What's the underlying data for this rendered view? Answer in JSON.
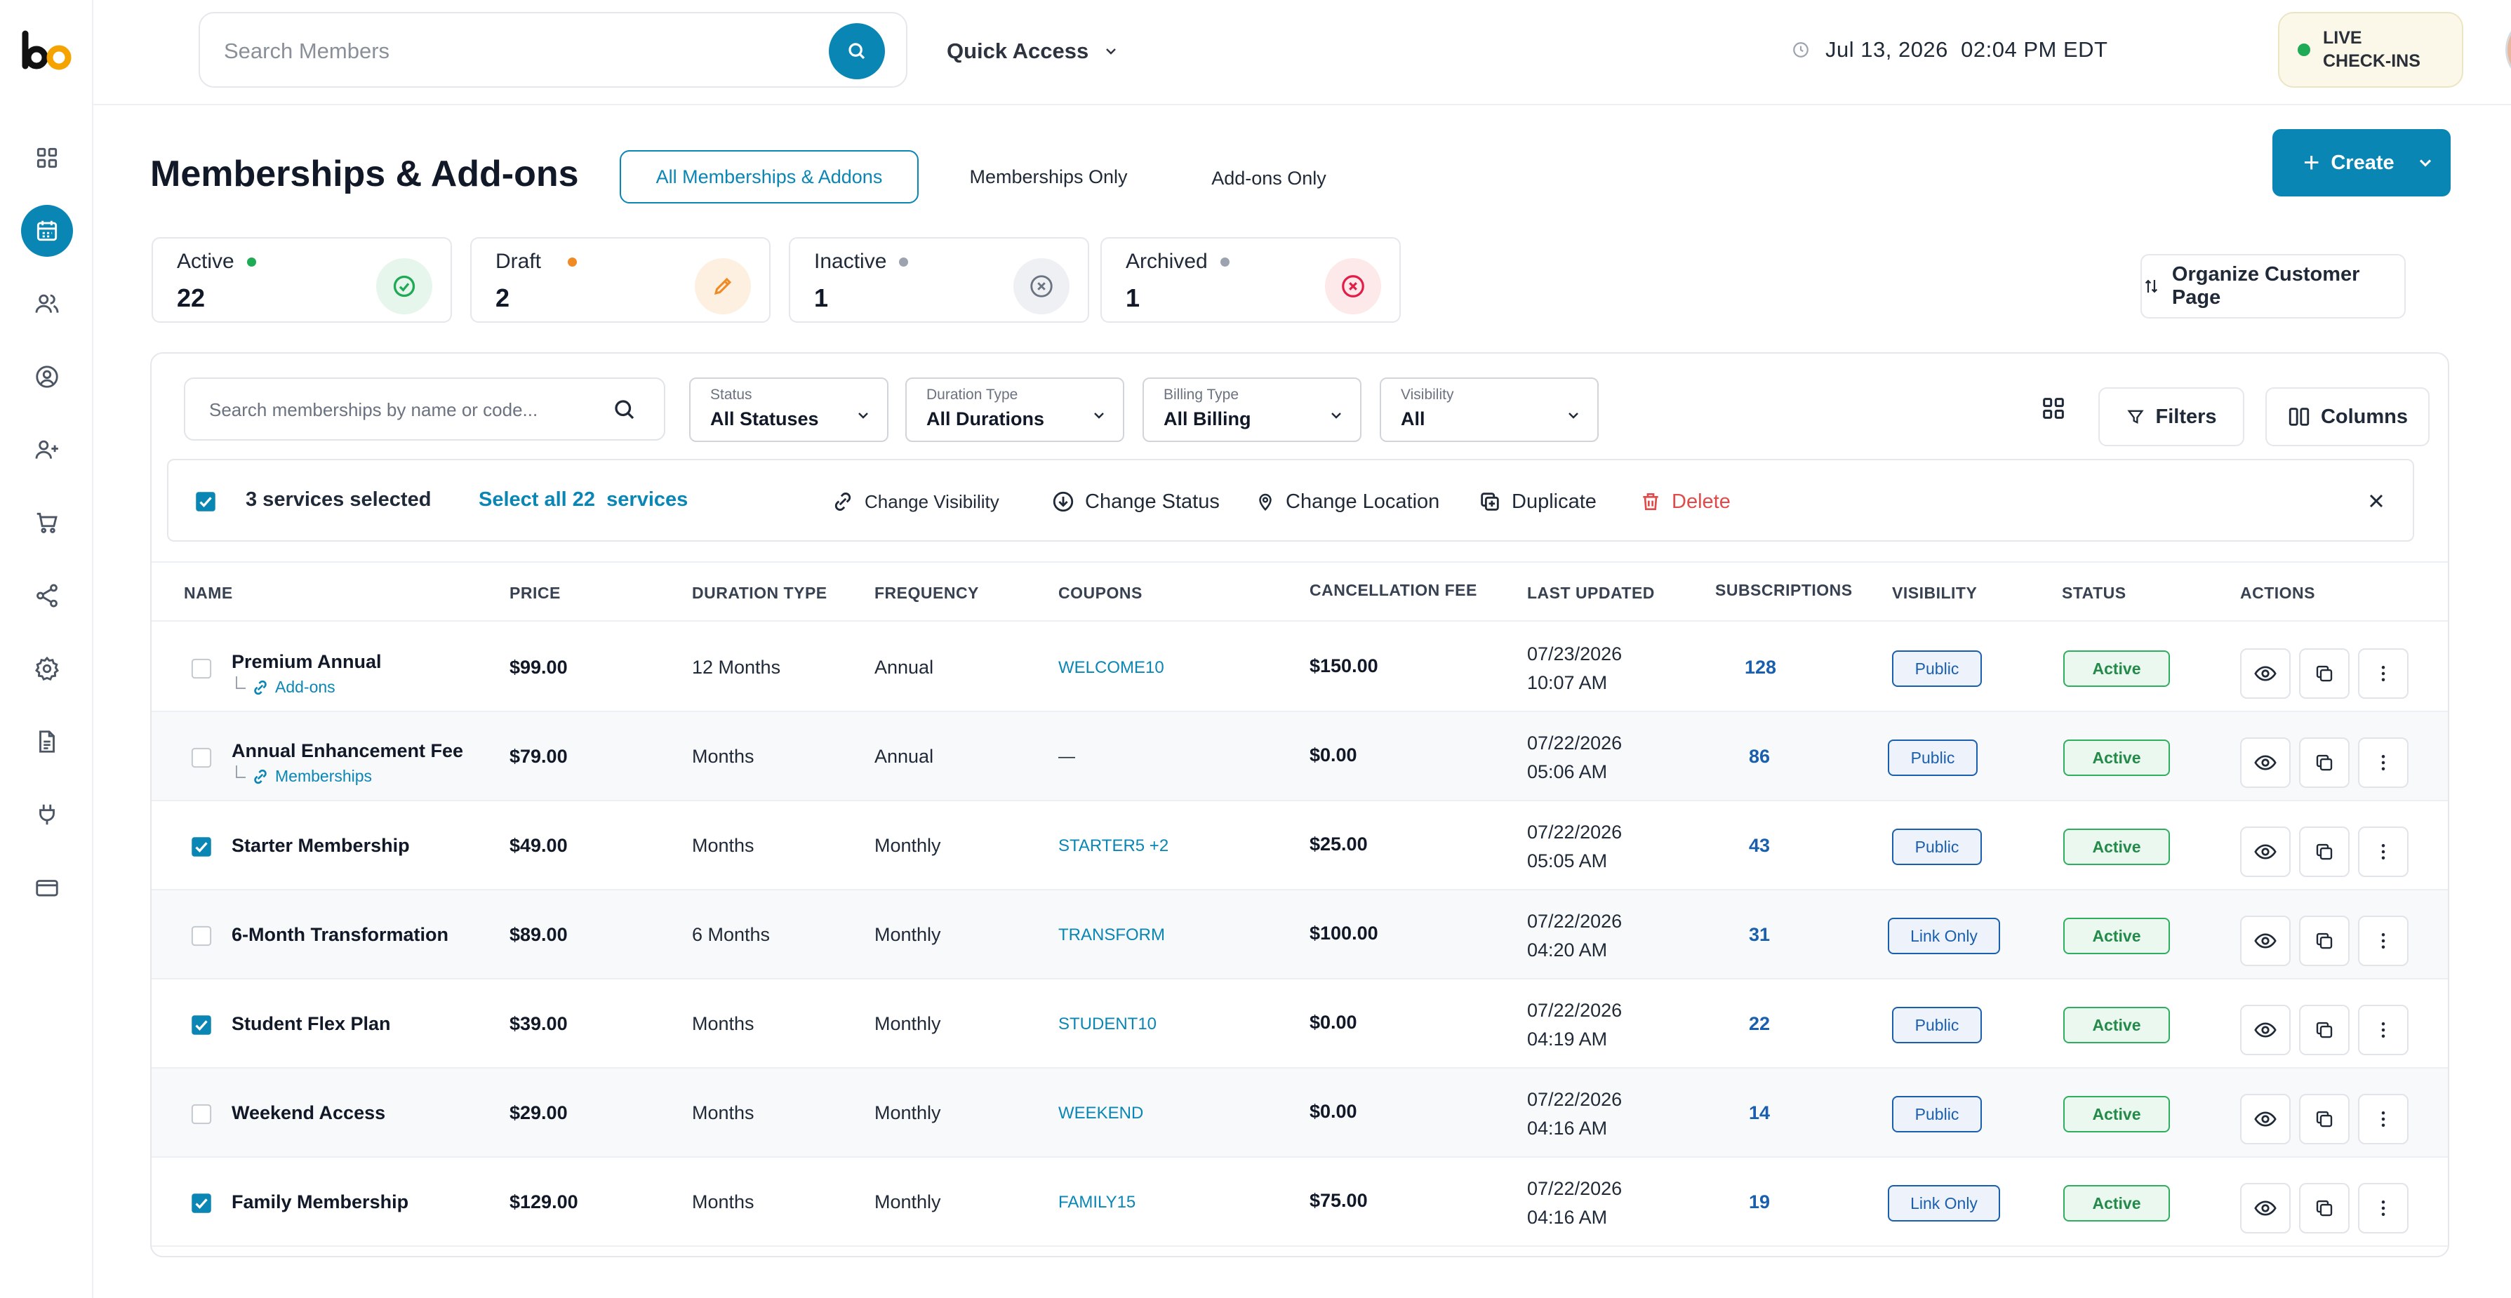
{
  "topbar": {
    "search_placeholder": "Search Members",
    "quick_access": "Quick Access",
    "datetime": "Jul 13, 2026  02:04 PM EDT",
    "live_checkins": "LIVE CHECK-INS"
  },
  "sidebar": {
    "items": [
      {
        "icon": "dashboard-icon"
      },
      {
        "icon": "calendar-icon",
        "active": true
      },
      {
        "icon": "users-icon"
      },
      {
        "icon": "user-circle-icon"
      },
      {
        "icon": "user-plus-icon"
      },
      {
        "icon": "cart-icon"
      },
      {
        "icon": "share-icon"
      },
      {
        "icon": "settings-icon"
      },
      {
        "icon": "document-icon"
      },
      {
        "icon": "plug-icon"
      },
      {
        "icon": "credit-card-icon"
      }
    ]
  },
  "page": {
    "title": "Memberships & Add-ons",
    "tabs": [
      "All Memberships & Addons",
      "Memberships Only",
      "Add-ons Only"
    ],
    "create_label": "Create",
    "organize_label": "Organize Customer Page"
  },
  "stats": [
    {
      "label": "Active",
      "value": "22",
      "color": "#1faa56"
    },
    {
      "label": "Draft",
      "value": "2",
      "color": "#f08a24"
    },
    {
      "label": "Inactive",
      "value": "1",
      "color": "#9ca3af"
    },
    {
      "label": "Archived",
      "value": "1",
      "color": "#9ca3af"
    }
  ],
  "filters": {
    "search_placeholder": "Search memberships by name or code...",
    "status": {
      "label": "Status",
      "value": "All Statuses"
    },
    "duration": {
      "label": "Duration Type",
      "value": "All Durations"
    },
    "billing": {
      "label": "Billing Type",
      "value": "All Billing"
    },
    "visibility": {
      "label": "Visibility",
      "value": "All"
    },
    "filters_label": "Filters",
    "columns_label": "Columns"
  },
  "bulk": {
    "selected_text": "3 services selected",
    "select_all": "Select all 22  services",
    "change_visibility": "Change Visibility",
    "change_status": "Change Status",
    "change_location": "Change Location",
    "duplicate": "Duplicate",
    "delete": "Delete"
  },
  "table": {
    "headers": [
      "NAME",
      "PRICE",
      "DURATION TYPE",
      "FREQUENCY",
      "COUPONS",
      "CANCELLATION FEE",
      "LAST UPDATED",
      "SUBSCRIPTIONS",
      "VISIBILITY",
      "STATUS",
      "ACTIONS"
    ],
    "rows": [
      {
        "name": "Premium Annual",
        "sub": "Add-ons",
        "price": "$99.00",
        "duration": "12 Months",
        "frequency": "Annual",
        "coupons": "WELCOME10",
        "fee": "$150.00",
        "date": "07/23/2026",
        "time": "10:07 AM",
        "subs": "128",
        "visibility": "Public",
        "status": "Active",
        "checked": false
      },
      {
        "name": "Annual Enhancement Fee",
        "sub": "Memberships",
        "price": "$79.00",
        "duration": "Months",
        "frequency": "Annual",
        "coupons": "—",
        "fee": "$0.00",
        "date": "07/22/2026",
        "time": "05:06 AM",
        "subs": "86",
        "visibility": "Public",
        "status": "Active",
        "checked": false
      },
      {
        "name": "Starter Membership",
        "sub": "",
        "price": "$49.00",
        "duration": "Months",
        "frequency": "Monthly",
        "coupons": "STARTER5 +2",
        "fee": "$25.00",
        "date": "07/22/2026",
        "time": "05:05 AM",
        "subs": "43",
        "visibility": "Public",
        "status": "Active",
        "checked": true
      },
      {
        "name": "6-Month Transformation",
        "sub": "",
        "price": "$89.00",
        "duration": "6 Months",
        "frequency": "Monthly",
        "coupons": "TRANSFORM",
        "fee": "$100.00",
        "date": "07/22/2026",
        "time": "04:20 AM",
        "subs": "31",
        "visibility": "Link Only",
        "status": "Active",
        "checked": false
      },
      {
        "name": "Student Flex Plan",
        "sub": "",
        "price": "$39.00",
        "duration": "Months",
        "frequency": "Monthly",
        "coupons": "STUDENT10",
        "fee": "$0.00",
        "date": "07/22/2026",
        "time": "04:19 AM",
        "subs": "22",
        "visibility": "Public",
        "status": "Active",
        "checked": true
      },
      {
        "name": "Weekend Access",
        "sub": "",
        "price": "$29.00",
        "duration": "Months",
        "frequency": "Monthly",
        "coupons": "WEEKEND",
        "fee": "$0.00",
        "date": "07/22/2026",
        "time": "04:16 AM",
        "subs": "14",
        "visibility": "Public",
        "status": "Active",
        "checked": false
      },
      {
        "name": "Family Membership",
        "sub": "",
        "price": "$129.00",
        "duration": "Months",
        "frequency": "Monthly",
        "coupons": "FAMILY15",
        "fee": "$75.00",
        "date": "07/22/2026",
        "time": "04:16 AM",
        "subs": "19",
        "visibility": "Link Only",
        "status": "Active",
        "checked": true
      }
    ]
  },
  "colors": {
    "accent": "#0a86b5",
    "link": "#1a5fae",
    "success": "#2fae5f",
    "danger": "#e24a4a"
  }
}
